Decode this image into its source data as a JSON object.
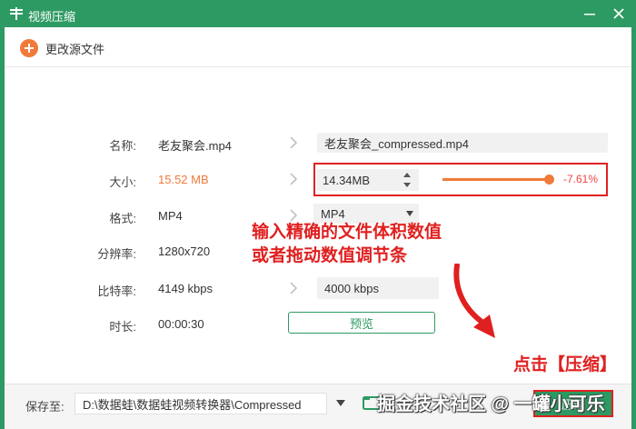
{
  "window": {
    "title": "视频压缩",
    "accent": "#2e9a63"
  },
  "toolbar": {
    "change_source_label": "更改源文件"
  },
  "form": {
    "name": {
      "label": "名称:",
      "value": "老友聚会.mp4",
      "output_value": "老友聚会_compressed.mp4"
    },
    "size": {
      "label": "大小:",
      "value": "15.52 MB",
      "input_value": "14.34MB",
      "percent": "-7.61%",
      "slider_fraction": 0.93
    },
    "format": {
      "label": "格式:",
      "value": "MP4",
      "selected": "MP4"
    },
    "resolution": {
      "label": "分辨率:",
      "value": "1280x720"
    },
    "bitrate": {
      "label": "比特率:",
      "value": "4149 kbps",
      "output_value": "4000 kbps"
    },
    "duration": {
      "label": "时长:",
      "value": "00:00:30"
    },
    "preview_label": "预览"
  },
  "annotations": {
    "line1": "输入精确的文件体积数值",
    "line2": "或者拖动数值调节条",
    "click_hint": "点击【压缩】",
    "color": "#e02020"
  },
  "footer": {
    "save_label": "保存至:",
    "path": "D:\\数据蛙\\数据蛙视频转换器\\Compressed",
    "compress_label": "压缩"
  },
  "watermark": "掘金技术社区 @ 一罐小可乐"
}
